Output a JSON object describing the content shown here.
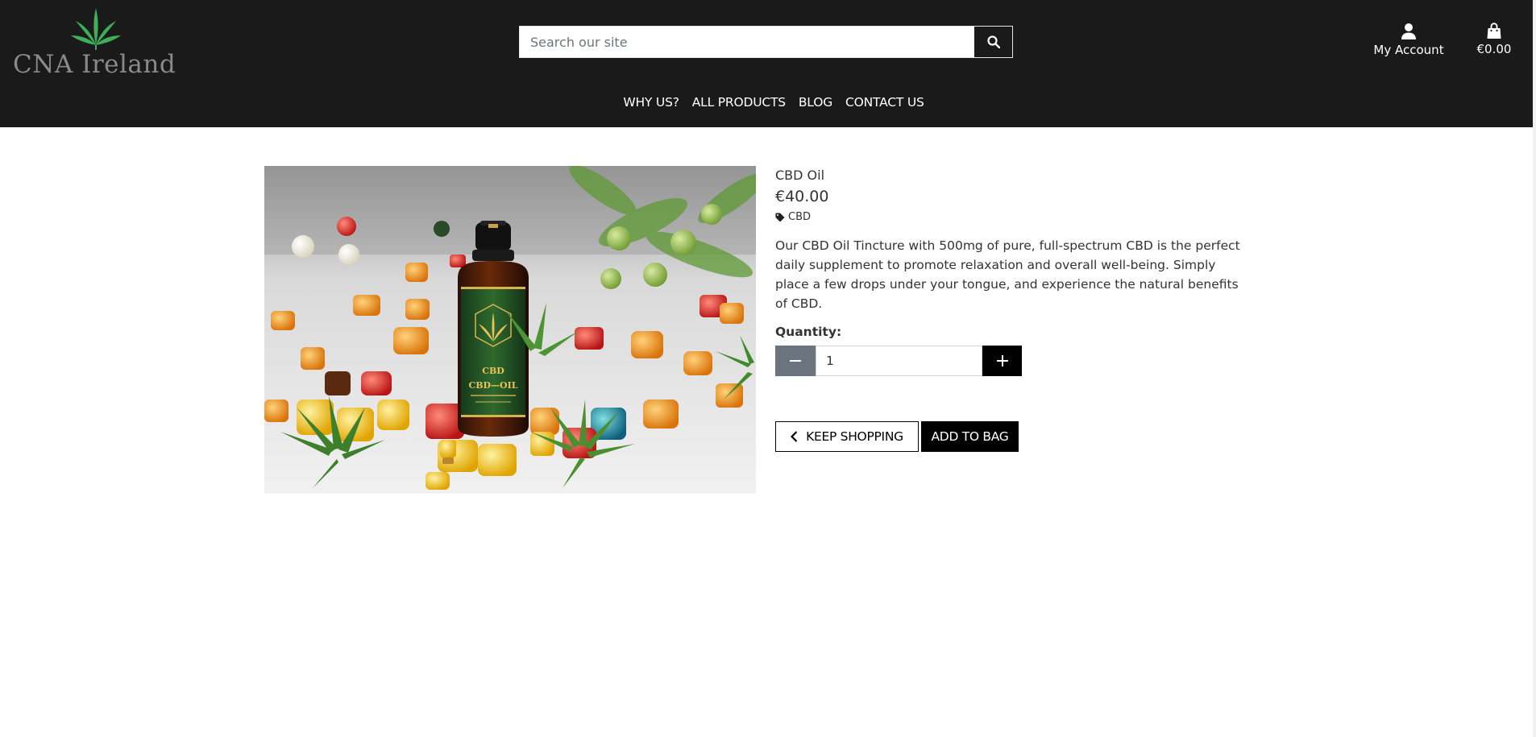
{
  "brand": {
    "name": "CNA Ireland",
    "logo_leaf_color": "#3fae5a",
    "logo_text_color": "#8a8a8a"
  },
  "header": {
    "background": "#1a1a1a",
    "search": {
      "placeholder": "Search our site",
      "button_icon": "search-icon"
    },
    "account": {
      "label": "My Account",
      "icon": "user-icon"
    },
    "bag": {
      "total": "€0.00",
      "icon": "shopping-bag-icon"
    },
    "nav": [
      {
        "label": "WHY US?"
      },
      {
        "label": "ALL PRODUCTS"
      },
      {
        "label": "BLOG"
      },
      {
        "label": "CONTACT US"
      }
    ]
  },
  "product": {
    "name": "CBD Oil",
    "price": "€40.00",
    "category": {
      "label": "CBD",
      "icon": "tag-icon"
    },
    "description": "Our CBD Oil Tincture with 500mg of pure, full-spectrum CBD is the perfect daily supplement to promote relaxation and overall well-being. Simply place a few drops under your tongue, and experience the natural benefits of CBD.",
    "image": {
      "bottle_label_line1": "CBD",
      "bottle_label_line2": "CBD—OIL"
    },
    "quantity": {
      "label": "Quantity:",
      "value": "1",
      "minus_icon": "minus-icon",
      "plus_icon": "plus-icon",
      "minus_color": "#6c757d",
      "plus_color": "#000000"
    },
    "buttons": {
      "keep_shopping": "KEEP SHOPPING",
      "add_to_bag": "ADD TO BAG"
    }
  }
}
